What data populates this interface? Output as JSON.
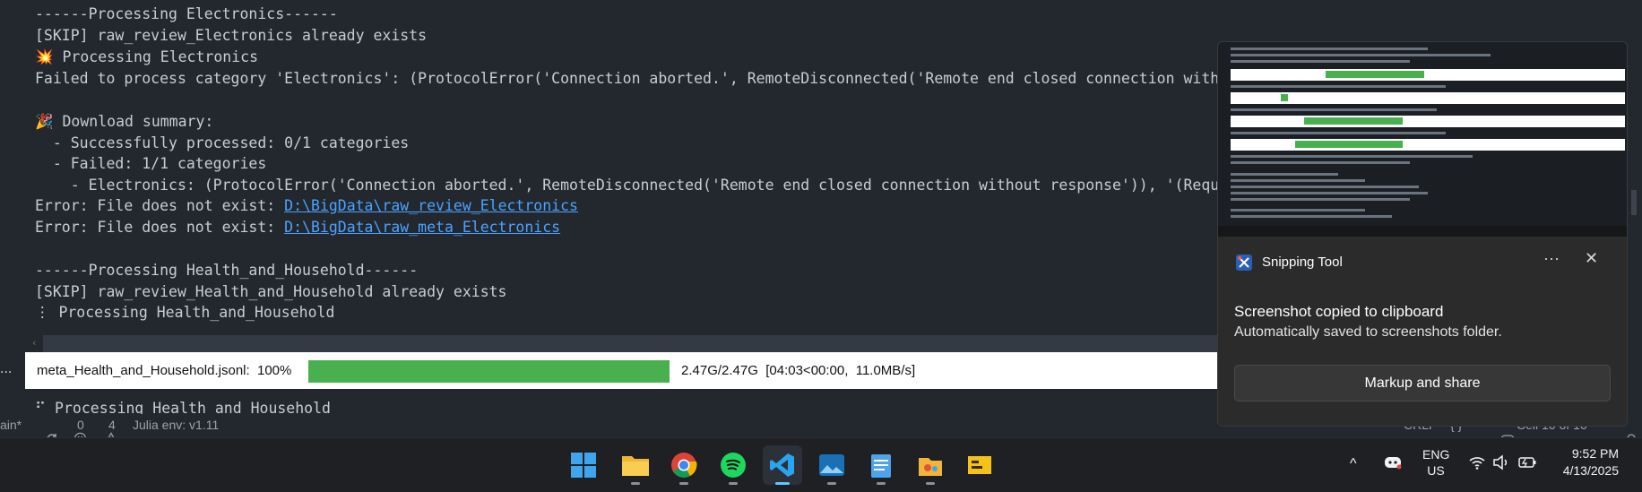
{
  "terminal": {
    "lines": [
      "------Processing Electronics------",
      "[SKIP] raw_review_Electronics already exists",
      "Processing Electronics",
      "Failed to process category 'Electronics': (ProtocolError('Connection aborted.', RemoteDisconnected('Remote end closed connection without",
      "Download summary:",
      "  - Successfully processed: 0/1 categories",
      "  - Failed: 1/1 categories",
      "    - Electronics: (ProtocolError('Connection aborted.', RemoteDisconnected('Remote end closed connection without response')), '(Request",
      "Error: File does not exist: ",
      "Error: File does not exist: ",
      "------Processing Health_and_Household------",
      "[SKIP] raw_review_Health_and_Household already exists",
      "Processing Health_and_Household",
      "Processing Health_and_Household"
    ],
    "links": [
      "D:\\BigData\\raw_review_Electronics",
      "D:\\BigData\\raw_meta_Electronics"
    ],
    "glyphs": {
      "boom": "💥",
      "party": "🎉",
      "spinner": "⋮",
      "spinner2": "⠋"
    },
    "left_dots": "..."
  },
  "progress": {
    "label": "meta_Health_and_Household.jsonl:  100%",
    "fraction": 1.0,
    "stats": "2.47G/2.47G  [04:03<00:00,  11.0MB/s]"
  },
  "statusbar": {
    "branch": "ain*",
    "errors": "0",
    "warnings": "4",
    "julia": "Julia env: v1.11",
    "eol": "CRLF",
    "braces": "{ }",
    "cell": "Cell 16 of 16"
  },
  "toast": {
    "app_name": "Snipping Tool",
    "title": "Screenshot copied to clipboard",
    "body": "Automatically saved to screenshots folder.",
    "button": "Markup and share",
    "more": "···",
    "close": "✕"
  },
  "taskbar": {
    "apps": [
      "windows-start",
      "file-explorer",
      "chrome",
      "spotify",
      "vscode",
      "photos",
      "notepad",
      "paint",
      "pdf-reader"
    ],
    "active": "vscode",
    "lang": "ENG",
    "region": "US",
    "time": "9:52 PM",
    "date": "4/13/2025",
    "chevron": "^"
  },
  "colors": {
    "terminal_bg": "#23272e",
    "terminal_text": "#c8ccd4",
    "link": "#4aa3ff",
    "progress_green": "#49b04f",
    "toast_bg": "#2b2b2b",
    "taskbar_bg": "#1e2024"
  }
}
